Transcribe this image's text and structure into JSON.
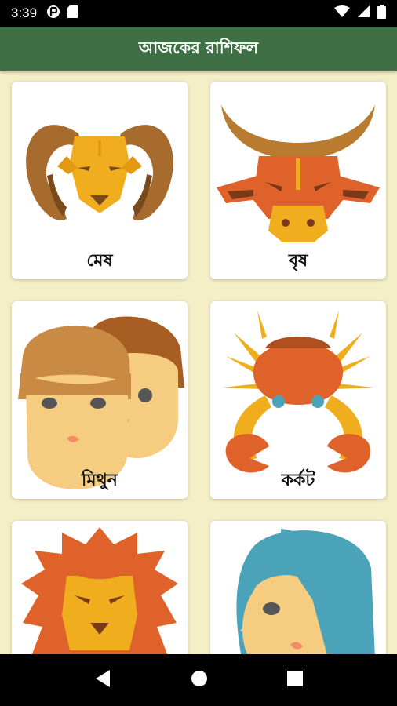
{
  "status_bar": {
    "time": "3:39",
    "left_icons": [
      "data-saver-icon",
      "sd-card-icon"
    ],
    "right_icons": [
      "wifi-icon",
      "signal-icon",
      "battery-icon"
    ]
  },
  "app_bar": {
    "title": "আজকের রাশিফল"
  },
  "signs": [
    {
      "name": "মেষ",
      "icon": "aries-ram-icon"
    },
    {
      "name": "বৃষ",
      "icon": "taurus-bull-icon"
    },
    {
      "name": "মিথুন",
      "icon": "gemini-twins-icon"
    },
    {
      "name": "কর্কট",
      "icon": "cancer-crab-icon"
    },
    {
      "name": "",
      "icon": "leo-lion-icon"
    },
    {
      "name": "",
      "icon": "virgo-maiden-icon"
    }
  ],
  "nav_bar": {
    "buttons": [
      "back-icon",
      "home-icon",
      "recents-icon"
    ]
  },
  "colors": {
    "app_bar": "#3f6f45",
    "background": "#f5efc8",
    "card": "#ffffff"
  }
}
